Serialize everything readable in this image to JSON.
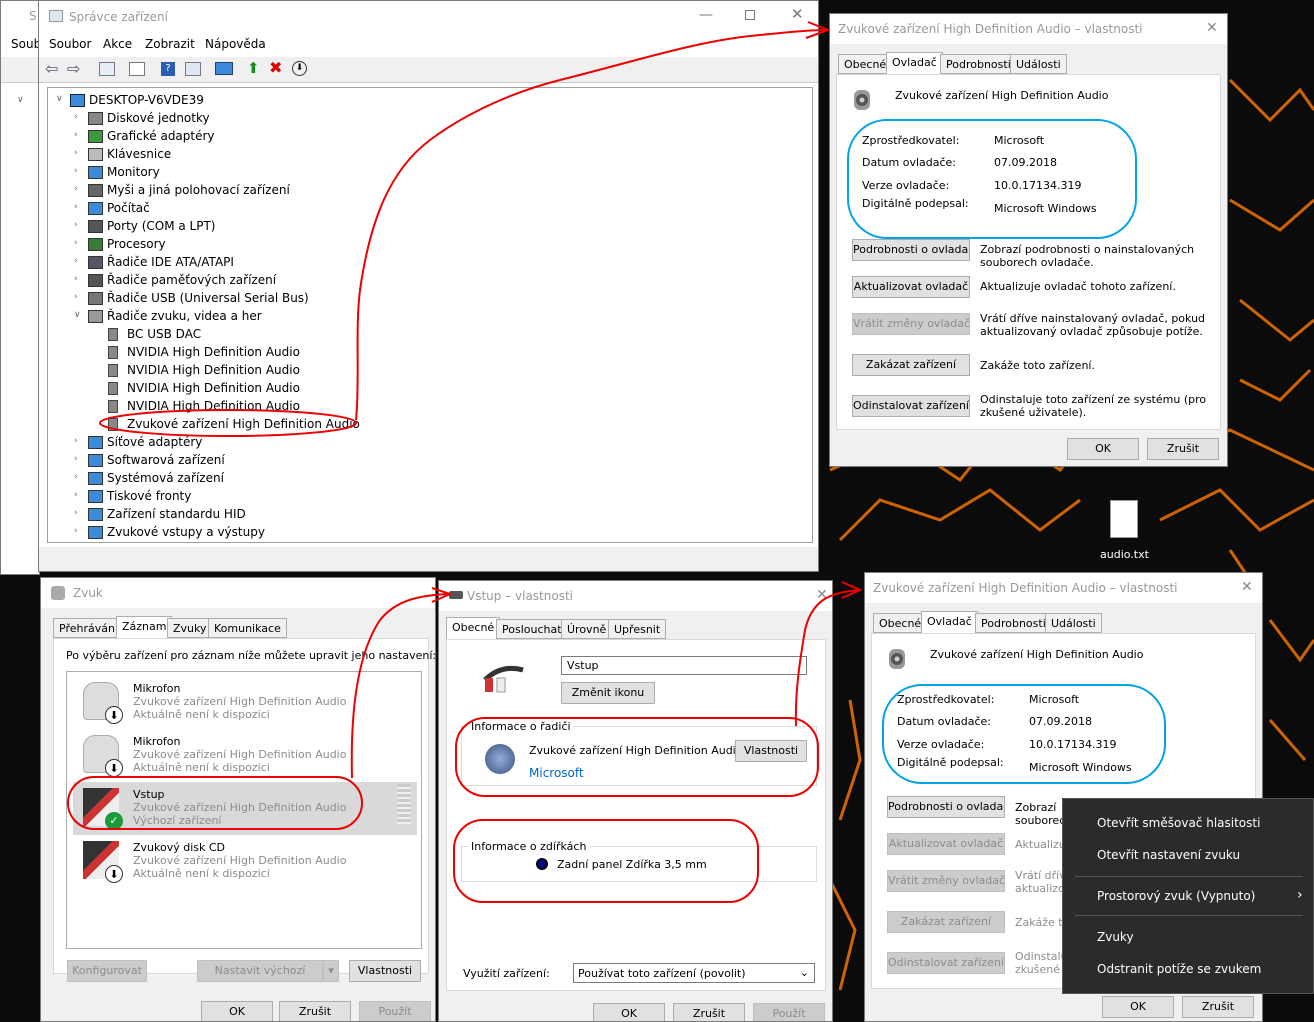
{
  "desktop": {
    "file_label": "audio.txt",
    "accent": "#ff7a00",
    "bg": "#0b0b0b"
  },
  "devmgr": {
    "title": "Správce zařízení",
    "behind_title_frag": "S",
    "behind_menu_frag": "Soub",
    "menu": [
      "Soubor",
      "Akce",
      "Zobrazit",
      "Nápověda"
    ],
    "root": "DESKTOP-V6VDE39",
    "items": [
      "Diskové jednotky",
      "Grafické adaptéry",
      "Klávesnice",
      "Monitory",
      "Myši a jiná polohovací zařízení",
      "Počítač",
      "Porty (COM a LPT)",
      "Procesory",
      "Řadiče IDE ATA/ATAPI",
      "Řadiče paměťových zařízení",
      "Řadiče USB (Universal Serial Bus)",
      "Řadiče zvuku, videa a her"
    ],
    "children": [
      "BC USB DAC",
      "NVIDIA High Definition Audio",
      "NVIDIA High Definition Audio",
      "NVIDIA High Definition Audio",
      "NVIDIA High Definition Audio",
      "Zvukové zařízení High Definition Audio"
    ],
    "items2": [
      "Síťové adaptéry",
      "Softwarová zařízení",
      "Systémová zařízení",
      "Tiskové fronty",
      "Zařízení standardu HID",
      "Zvukové vstupy a výstupy"
    ]
  },
  "props": {
    "title": "Zvukové zařízení High Definition Audio – vlastnosti",
    "tabs": [
      "Obecné",
      "Ovladač",
      "Podrobnosti",
      "Události"
    ],
    "device": "Zvukové zařízení High Definition Audio",
    "provider_label": "Zprostředkovatel:",
    "provider": "Microsoft",
    "date_label": "Datum ovladače:",
    "date": "07.09.2018",
    "version_label": "Verze ovladače:",
    "version": "10.0.17134.319",
    "signer_label": "Digitálně podepsal:",
    "signer": "Microsoft Windows",
    "b1": "Podrobnosti o ovladači",
    "d1": "Zobrazí podrobnosti o nainstalovaných souborech ovladače.",
    "b2": "Aktualizovat ovladač",
    "d2": "Aktualizuje ovladač tohoto zařízení.",
    "b3": "Vrátit změny ovladače",
    "d3": "Vrátí dříve nainstalovaný ovladač, pokud aktualizovaný ovladač způsobuje potíže.",
    "b4": "Zakázat zařízení",
    "d4": "Zakáže toto zařízení.",
    "b5": "Odinstalovat zařízení",
    "d5": "Odinstaluje toto zařízení ze systému (pro zkušené uživatele).",
    "ok": "OK",
    "cancel": "Zrušit",
    "frag": {
      "d1a": "Zobrazí",
      "d1b": "souborec",
      "d2": "Aktualizuj",
      "d3a": "Vrátí dřív",
      "d3b": "aktualizov",
      "d4": "Zakáže to",
      "d5a": "Odinstaluj",
      "d5b": "zkušené u"
    }
  },
  "sound": {
    "title": "Zvuk",
    "tabs": [
      "Přehrávání",
      "Záznam",
      "Zvuky",
      "Komunikace"
    ],
    "hint": "Po výběru zařízení pro záznam níže můžete upravit jeho nastavení:",
    "devices": [
      {
        "name": "Mikrofon",
        "sub": "Zvukové zařízení High Definition Audio",
        "status": "Aktuálně není k dispozici"
      },
      {
        "name": "Mikrofon",
        "sub": "Zvukové zařízení High Definition Audio",
        "status": "Aktuálně není k dispozici"
      },
      {
        "name": "Vstup",
        "sub": "Zvukové zařízení High Definition Audio",
        "status": "Výchozí zařízení"
      },
      {
        "name": "Zvukový disk CD",
        "sub": "Zvukové zařízení High Definition Audio",
        "status": "Aktuálně není k dispozici"
      }
    ],
    "configure": "Konfigurovat",
    "set_default": "Nastavit výchozí",
    "properties": "Vlastnosti",
    "ok": "OK",
    "cancel": "Zrušit",
    "apply": "Použít"
  },
  "vstup": {
    "title": "Vstup – vlastnosti",
    "tabs": [
      "Obecné",
      "Poslouchat",
      "Úrovně",
      "Upřesnit"
    ],
    "name": "Vstup",
    "change_icon": "Změnit ikonu",
    "ctrl_group": "Informace o řadiči",
    "ctrl_name": "Zvukové zařízení High Definition Audio",
    "ctrl_vendor": "Microsoft",
    "ctrl_props": "Vlastnosti",
    "jack_group": "Informace o zdířkách",
    "jack": "Zadní panel Zdířka 3,5 mm",
    "usage_label": "Využití zařízení:",
    "usage_value": "Používat toto zařízení (povolit)",
    "ok": "OK",
    "cancel": "Zrušit",
    "apply": "Použít"
  },
  "context": {
    "items": [
      "Otevřít směšovač hlasitosti",
      "Otevřít nastavení zvuku",
      "Prostorový zvuk (Vypnuto)",
      "Zvuky",
      "Odstranit potíže se zvukem"
    ]
  }
}
